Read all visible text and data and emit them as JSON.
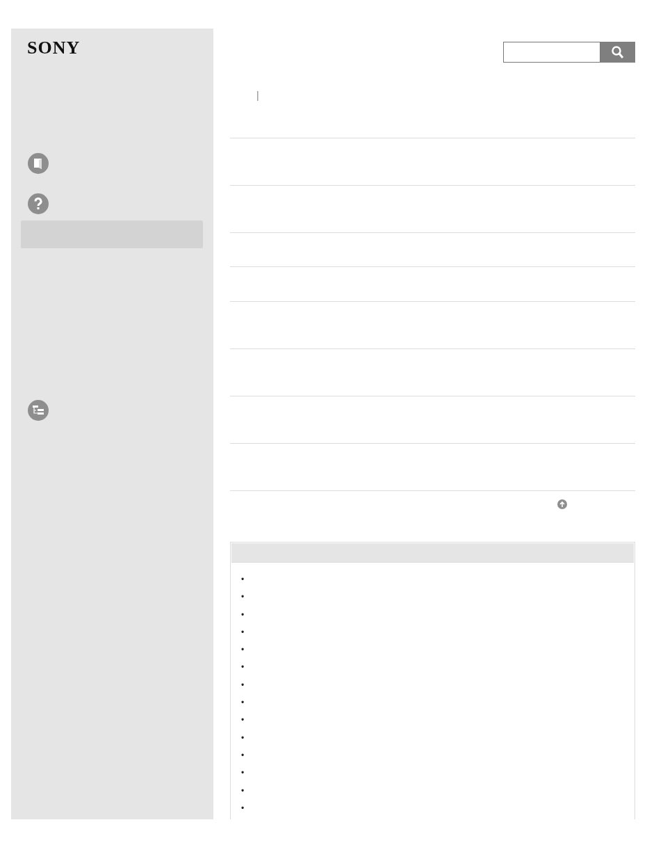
{
  "logo": "SONY",
  "breadcrumb": {
    "separator": "|"
  },
  "related_list": {
    "items": [
      {
        "marker": "•"
      },
      {
        "marker": "•"
      },
      {
        "marker": "•"
      },
      {
        "marker": "•"
      },
      {
        "marker": "•"
      },
      {
        "marker": "•"
      },
      {
        "marker": "•"
      },
      {
        "marker": "•"
      },
      {
        "marker": "•"
      },
      {
        "marker": "•"
      },
      {
        "marker": "•"
      },
      {
        "marker": "•"
      },
      {
        "marker": "•"
      },
      {
        "marker": "•"
      }
    ]
  }
}
